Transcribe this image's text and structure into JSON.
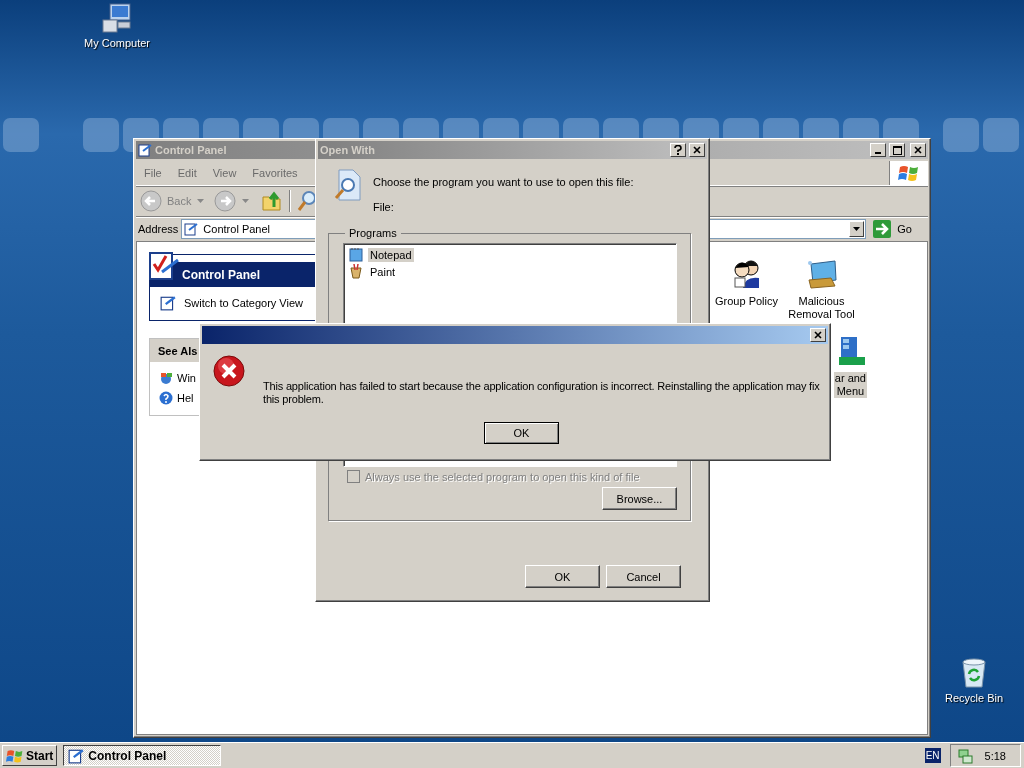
{
  "desktop_icons": [
    {
      "label": "My Computer",
      "kind": "computer"
    },
    {
      "label": "Recycle Bin",
      "kind": "recycle"
    }
  ],
  "control_panel": {
    "title": "Control Panel",
    "active": false,
    "menu": [
      "File",
      "Edit",
      "View",
      "Favorites"
    ],
    "back": {
      "label": "Back",
      "disabled": true
    },
    "address": {
      "label": "Address",
      "value": "Control Panel",
      "go": "Go"
    },
    "task_pane": {
      "title": "Control Panel",
      "link": "Switch to Category View"
    },
    "see_also": {
      "title": "See Als",
      "links": [
        {
          "label": "Win",
          "kind": "windows"
        },
        {
          "label": "Hel",
          "kind": "help"
        }
      ]
    },
    "items": [
      {
        "label": "Group Policy",
        "kind": "policy",
        "selected": false
      },
      {
        "label": "Malicious\nRemoval Tool",
        "kind": "tool",
        "selected": false
      },
      {
        "label": "ar and\nMenu",
        "kind": "taskbar",
        "selected": true
      }
    ]
  },
  "open_with": {
    "title": "Open With",
    "active": false,
    "prompt": "Choose the program you want to use to open this file:",
    "file_label": "File:",
    "group": "Programs",
    "programs": [
      {
        "name": "Notepad",
        "kind": "notepad",
        "selected": true
      },
      {
        "name": "Paint",
        "kind": "paint",
        "selected": false
      }
    ],
    "always": {
      "label": "Always use the selected program to open this kind of file",
      "checked": false,
      "disabled": true
    },
    "browse": "Browse...",
    "ok": "OK",
    "cancel": "Cancel"
  },
  "error_dialog": {
    "active": true,
    "message": "This application has failed to start because the application configuration is incorrect. Reinstalling the application may fix this problem.",
    "ok": "OK"
  },
  "taskbar": {
    "start": "Start",
    "tasks": [
      {
        "label": "Control Panel",
        "selected": true
      }
    ],
    "language": "EN",
    "clock": "5:18"
  }
}
